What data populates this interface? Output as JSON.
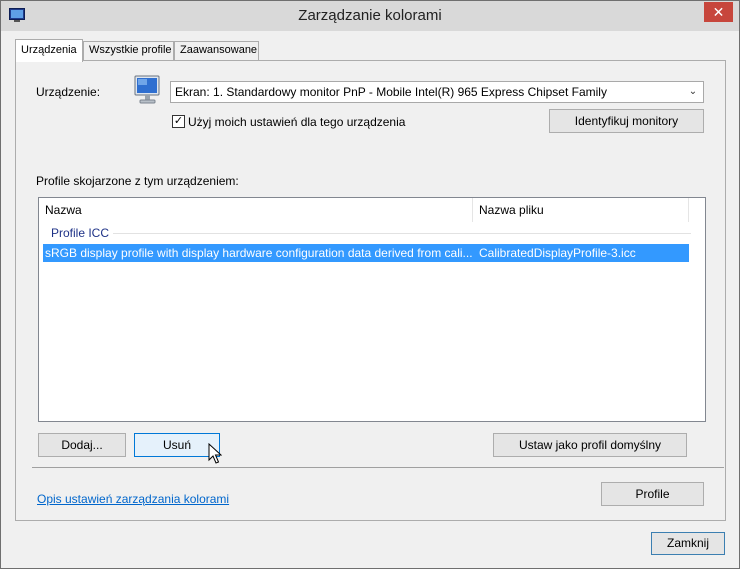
{
  "window": {
    "title": "Zarządzanie kolorami",
    "close_glyph": "✕",
    "icons": {
      "app": "color-management-icon",
      "monitor": "monitor-icon",
      "cursor": "mouse-pointer-icon"
    }
  },
  "tabs": [
    {
      "label": "Urządzenia",
      "active": true
    },
    {
      "label": "Wszystkie profile",
      "active": false
    },
    {
      "label": "Zaawansowane",
      "active": false
    }
  ],
  "device": {
    "label": "Urządzenie:",
    "selected": "Ekran: 1. Standardowy monitor PnP - Mobile Intel(R) 965 Express Chipset Family",
    "arrow_glyph": "⌄",
    "use_my_settings": {
      "checked": true,
      "check_glyph": "✓",
      "label": "Użyj moich ustawień dla tego urządzenia"
    },
    "identify_button": "Identyfikuj monitory"
  },
  "profiles": {
    "section_label": "Profile skojarzone z tym urządzeniem:",
    "columns": [
      "Nazwa",
      "Nazwa pliku"
    ],
    "group": "Profile ICC",
    "rows": [
      {
        "name": "sRGB display profile with display hardware configuration data derived from cali...",
        "file": "CalibratedDisplayProfile-3.icc",
        "selected": true
      }
    ]
  },
  "buttons": {
    "add": "Dodaj...",
    "remove": "Usuń",
    "set_default": "Ustaw jako profil domyślny",
    "profile": "Profile",
    "close": "Zamknij"
  },
  "link": "Opis ustawień zarządzania kolorami",
  "colors": {
    "selection": "#3399ff",
    "link": "#0066cc",
    "close_button": "#c7463c"
  }
}
